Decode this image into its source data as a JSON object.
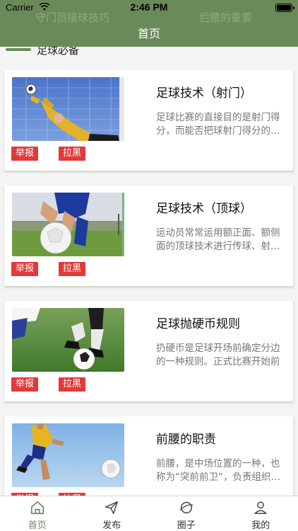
{
  "status": {
    "carrier": "Carrier",
    "time": "2:46 PM"
  },
  "nav": {
    "title": "首页",
    "ghost_left": "守门员接球技巧",
    "ghost_right": "后腰的重要"
  },
  "section": {
    "title": "足球必备"
  },
  "cards": [
    {
      "title": "足球技术（射门）",
      "desc": "足球比赛的直接目的是射门得分，而能否把球射门得分的关键在于",
      "report": "举报",
      "block": "拉黑"
    },
    {
      "title": "足球技术（顶球）",
      "desc": "运动员常常运用额正面、额侧面的顶球技术进行传球、射门等",
      "report": "举报",
      "block": "拉黑"
    },
    {
      "title": "足球抛硬币规则",
      "desc": "扔硬币是足球开场前确定分边的一种规则。正式比赛开始前",
      "report": "举报",
      "block": "拉黑"
    },
    {
      "title": "前腰的职责",
      "desc": "前腰，是中场位置的一种，也称为“突前前卫”，负责组织进攻",
      "report": "举报",
      "block": "拉黑"
    }
  ],
  "tabs": [
    {
      "label": "首页",
      "icon": "home-icon",
      "active": true
    },
    {
      "label": "发布",
      "icon": "send-icon",
      "active": false
    },
    {
      "label": "圈子",
      "icon": "planet-icon",
      "active": false
    },
    {
      "label": "我的",
      "icon": "user-icon",
      "active": false
    }
  ],
  "colors": {
    "primary": "#6b8a5a",
    "tag": "#e03a3a"
  }
}
